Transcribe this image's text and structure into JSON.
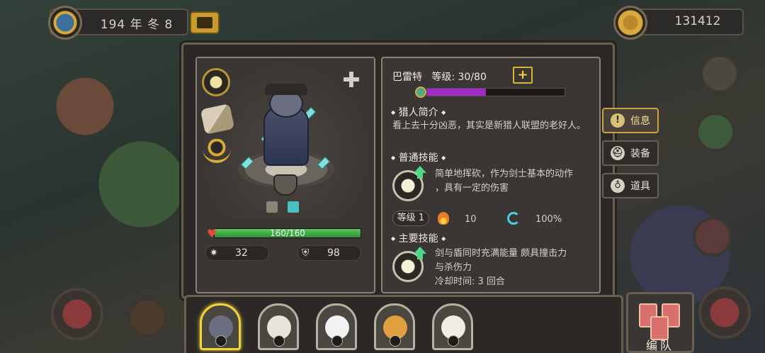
{
  "top_bar": {
    "date": "194 年 冬 8",
    "gold": "131412"
  },
  "hero": {
    "name": "巴雷特",
    "level_label": "等级: 30/80",
    "xp_fraction": 0.43,
    "hp_text": "160/160",
    "hp_fraction": 1.0,
    "attack": "32",
    "defense": "98"
  },
  "sections": {
    "intro_title": "猎人简介",
    "intro_text": "看上去十分凶恶，其实是新猎人联盟的老好人。",
    "normal_skill_title": "普通技能",
    "normal_skill_text_1": "简单地挥砍，作为剑士基本的动作",
    "normal_skill_text_2": "，具有一定的伤害",
    "skill_level": "等级 1",
    "skill_cost": "10",
    "skill_rate": "100%",
    "main_skill_title": "主要技能",
    "main_skill_text_1": "剑与盾同时充满能量 颇具撞击力",
    "main_skill_text_2": "与杀伤力",
    "cooldown": "冷却时间: 3 回合"
  },
  "tabs": {
    "info": "信息",
    "equip": "装备",
    "items": "道具"
  },
  "bottom": {
    "formation": "编队"
  },
  "colors": {
    "hp": "#3fae44",
    "xp": "#a12bc9",
    "gold_accent": "#d9b43a"
  }
}
